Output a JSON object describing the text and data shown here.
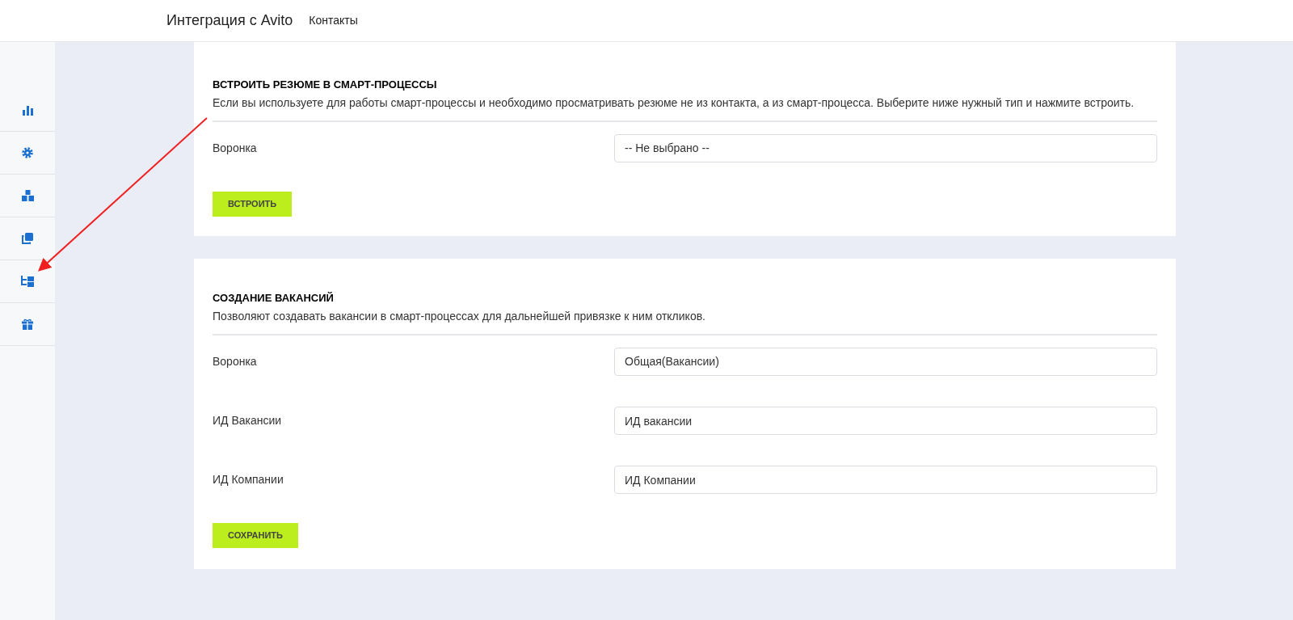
{
  "header": {
    "title": "Интеграция с Avito",
    "links": [
      "Контакты"
    ]
  },
  "sections": [
    {
      "title": "ВСТРОИТЬ РЕЗЮМЕ В СМАРТ-ПРОЦЕССЫ",
      "description": "Если вы используете для работы смарт-процессы и необходимо просматривать резюме не из контакта, а из смарт-процесса. Выберите ниже нужный тип и нажмите встроить.",
      "fields": [
        {
          "label": "Воронка",
          "kind": "select",
          "value": "-- Не выбрано --"
        }
      ],
      "button": "ВСТРОИТЬ"
    },
    {
      "title": "СОЗДАНИЕ ВАКАНСИЙ",
      "description": "Позволяют создавать вакансии в смарт-процессах для дальнейшей привязке к ним откликов.",
      "fields": [
        {
          "label": "Воронка",
          "kind": "select",
          "value": "Общая(Вакансии)"
        },
        {
          "label": "ИД Вакансии",
          "kind": "input",
          "value": "ИД вакансии"
        },
        {
          "label": "ИД Компании",
          "kind": "input",
          "value": "ИД Компании"
        }
      ],
      "button": "СОХРАНИТЬ"
    }
  ]
}
